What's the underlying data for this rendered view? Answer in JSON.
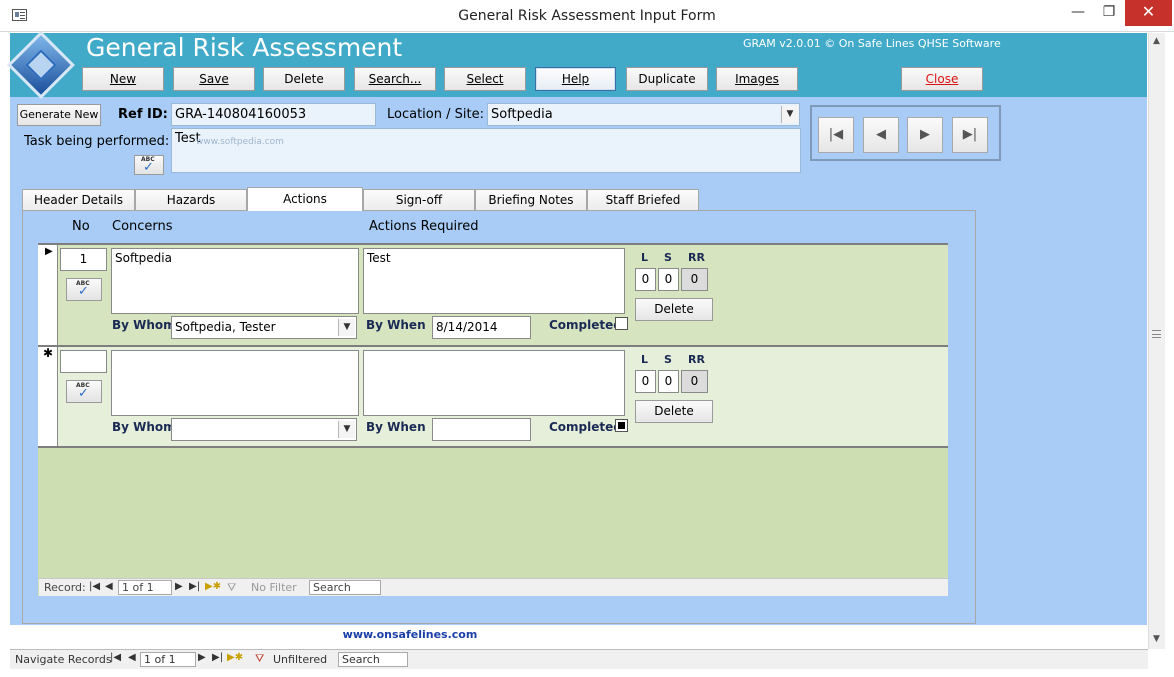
{
  "window": {
    "title": "General Risk Assessment Input Form",
    "minimize": "—",
    "restore": "❐",
    "close": "✕"
  },
  "header": {
    "app_title": "General Risk Assessment",
    "version": "GRAM v2.0.01 © On Safe Lines QHSE Software",
    "buttons": {
      "new": "New",
      "save": "Save",
      "delete": "Delete",
      "search": "Search...",
      "select": "Select",
      "help": "Help",
      "duplicate": "Duplicate",
      "images": "Images",
      "close": "Close"
    }
  },
  "form": {
    "generate_new": "Generate New",
    "ref_id_label": "Ref ID:",
    "ref_id_value": "GRA-140804160053",
    "location_label": "Location / Site:",
    "location_value": "Softpedia",
    "task_label": "Task being performed:",
    "task_value": "Test",
    "watermark": "www.softpedia.com"
  },
  "record_nav_buttons": {
    "first": "|◀",
    "prev": "◀",
    "next": "▶",
    "last": "▶|"
  },
  "tabs": [
    "Header Details",
    "Hazards",
    "Actions",
    "Sign-off",
    "Briefing Notes",
    "Staff Briefed"
  ],
  "active_tab": "Actions",
  "actions": {
    "col_no": "No",
    "col_concerns": "Concerns",
    "col_actions": "Actions Required",
    "by_whom_label": "By Whom",
    "by_when_label": "By When",
    "completed_label": "Completed",
    "l_label": "L",
    "s_label": "S",
    "rr_label": "RR",
    "delete_label": "Delete",
    "rows": [
      {
        "selector": "▶",
        "no": "1",
        "concern": "Softpedia",
        "action": "Test",
        "by_whom": "Softpedia, Tester",
        "by_when": "8/14/2014",
        "l": "0",
        "s": "0",
        "rr": "0",
        "completed": false
      },
      {
        "selector": "✱",
        "no": "",
        "concern": "",
        "action": "",
        "by_whom": "",
        "by_when": "",
        "l": "0",
        "s": "0",
        "rr": "0",
        "completed": true
      }
    ]
  },
  "subform_nav": {
    "record_label": "Record:",
    "position": "1 of 1",
    "filter": "No Filter",
    "search": "Search"
  },
  "website": "www.onsafelines.com",
  "statusbar": {
    "label": "Navigate Records",
    "position": "1 of 1",
    "filter": "Unfiltered",
    "search": "Search"
  }
}
